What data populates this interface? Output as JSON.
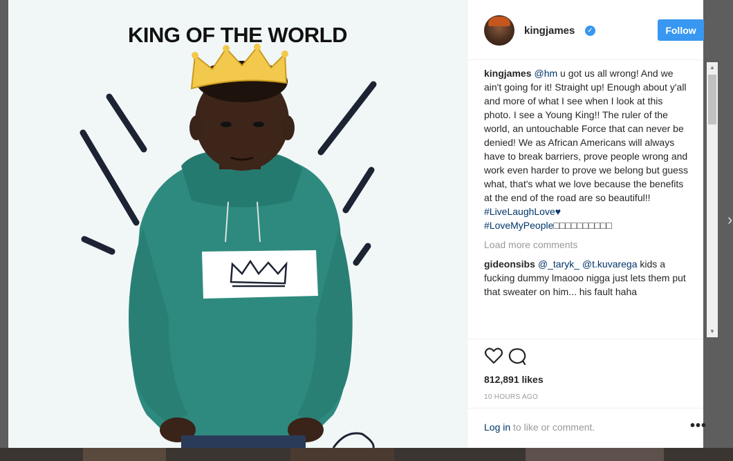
{
  "photo": {
    "title": "KING OF THE WORLD"
  },
  "post": {
    "username": "kingjames",
    "follow_label": "Follow",
    "comments": [
      {
        "user": "kingjames",
        "mention": "@hm",
        "text": " u got us all wrong! And we ain't going for it! Straight up! Enough about y'all and more of what I see when I look at this photo. I see a Young King!! The ruler of the world, an untouchable Force that can never be denied! We as African Americans will always have to break barriers, prove people wrong and work even harder to prove we belong but guess what, that's what we love because the benefits at the end of the road are so beautiful!! ",
        "hashtag1": "#LiveLaughLove",
        "heart": "♥",
        "hashtag2": "#LoveMyPeople",
        "trail": "□□□□□□□□□□"
      },
      {
        "user": "gideonsibs",
        "mention1": "@_taryk_",
        "mention2": "@t.kuvarega",
        "text": " kids a fucking dummy lmaooo nigga just lets them put that sweater on him... his fault haha"
      }
    ],
    "load_more": "Load more comments",
    "likes": "812,891 likes",
    "time_ago": "10 HOURS AGO",
    "login_link": "Log in",
    "login_rest": " to like or comment.",
    "more": "•••"
  }
}
